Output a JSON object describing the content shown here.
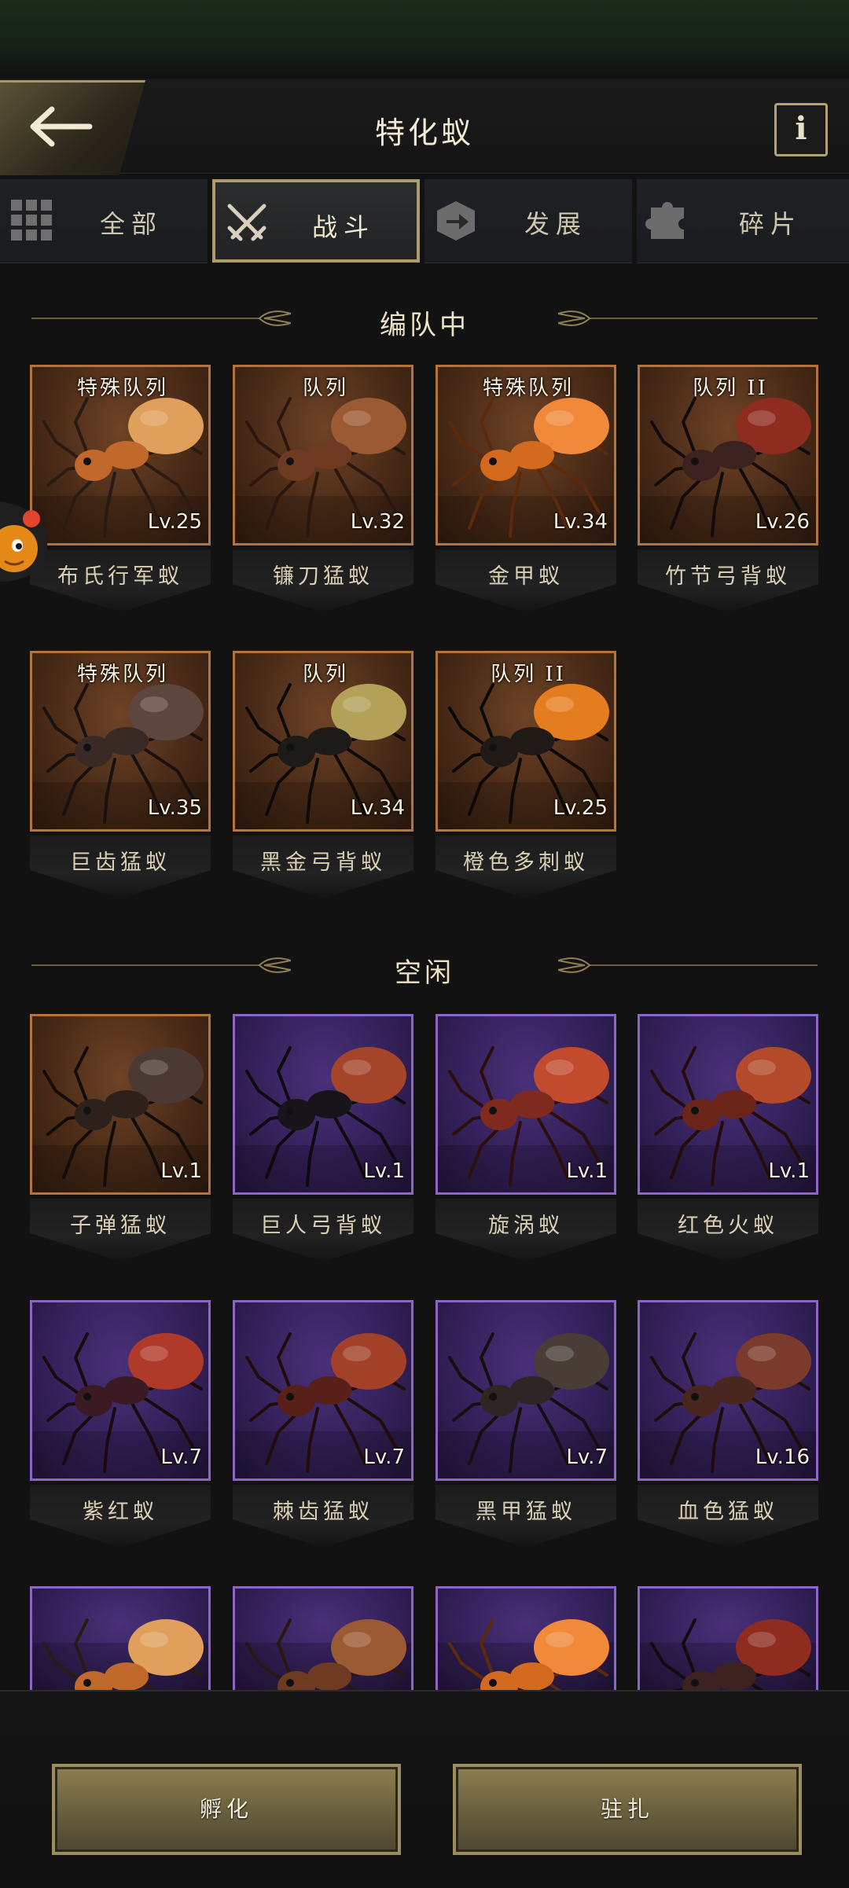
{
  "header": {
    "title": "特化蚁",
    "back_icon": "back-arrow-icon",
    "info_label": "i"
  },
  "tabs": [
    {
      "label": "全部",
      "icon": "grid-icon",
      "active": false
    },
    {
      "label": "战斗",
      "icon": "crossed-swords-icon",
      "active": true
    },
    {
      "label": "发展",
      "icon": "arrow-cube-icon",
      "active": false
    },
    {
      "label": "碎片",
      "icon": "puzzle-icon",
      "active": false
    }
  ],
  "sections": {
    "formation_title": "编队中",
    "idle_title": "空闲"
  },
  "formation": [
    {
      "name": "布氏行军蚁",
      "badge": "特殊队列",
      "level": "Lv.25",
      "rarity": "orange"
    },
    {
      "name": "镰刀猛蚁",
      "badge": "队列",
      "level": "Lv.32",
      "rarity": "orange"
    },
    {
      "name": "金甲蚁",
      "badge": "特殊队列",
      "level": "Lv.34",
      "rarity": "orange"
    },
    {
      "name": "竹节弓背蚁",
      "badge": "队列 II",
      "level": "Lv.26",
      "rarity": "orange"
    },
    {
      "name": "巨齿猛蚁",
      "badge": "特殊队列",
      "level": "Lv.35",
      "rarity": "orange"
    },
    {
      "name": "黑金弓背蚁",
      "badge": "队列",
      "level": "Lv.34",
      "rarity": "orange"
    },
    {
      "name": "橙色多刺蚁",
      "badge": "队列 II",
      "level": "Lv.25",
      "rarity": "orange"
    }
  ],
  "idle": [
    {
      "name": "子弹猛蚁",
      "level": "Lv.1",
      "rarity": "orange"
    },
    {
      "name": "巨人弓背蚁",
      "level": "Lv.1",
      "rarity": "purple"
    },
    {
      "name": "旋涡蚁",
      "level": "Lv.1",
      "rarity": "purple"
    },
    {
      "name": "红色火蚁",
      "level": "Lv.1",
      "rarity": "purple"
    },
    {
      "name": "紫红蚁",
      "level": "Lv.7",
      "rarity": "purple"
    },
    {
      "name": "棘齿猛蚁",
      "level": "Lv.7",
      "rarity": "purple"
    },
    {
      "name": "黑甲猛蚁",
      "level": "Lv.7",
      "rarity": "purple"
    },
    {
      "name": "血色猛蚁",
      "level": "Lv.16",
      "rarity": "purple"
    },
    {
      "name": "",
      "level": "",
      "rarity": "purple"
    },
    {
      "name": "",
      "level": "",
      "rarity": "purple"
    },
    {
      "name": "",
      "level": "",
      "rarity": "purple"
    },
    {
      "name": "",
      "level": "",
      "rarity": "purple"
    }
  ],
  "actions": {
    "hatch_label": "孵化",
    "station_label": "驻扎"
  },
  "colors": {
    "accent_gold": "#b09c66",
    "orange_frame": "#b4733b",
    "purple_frame": "#8c65c7",
    "background": "#121212"
  }
}
